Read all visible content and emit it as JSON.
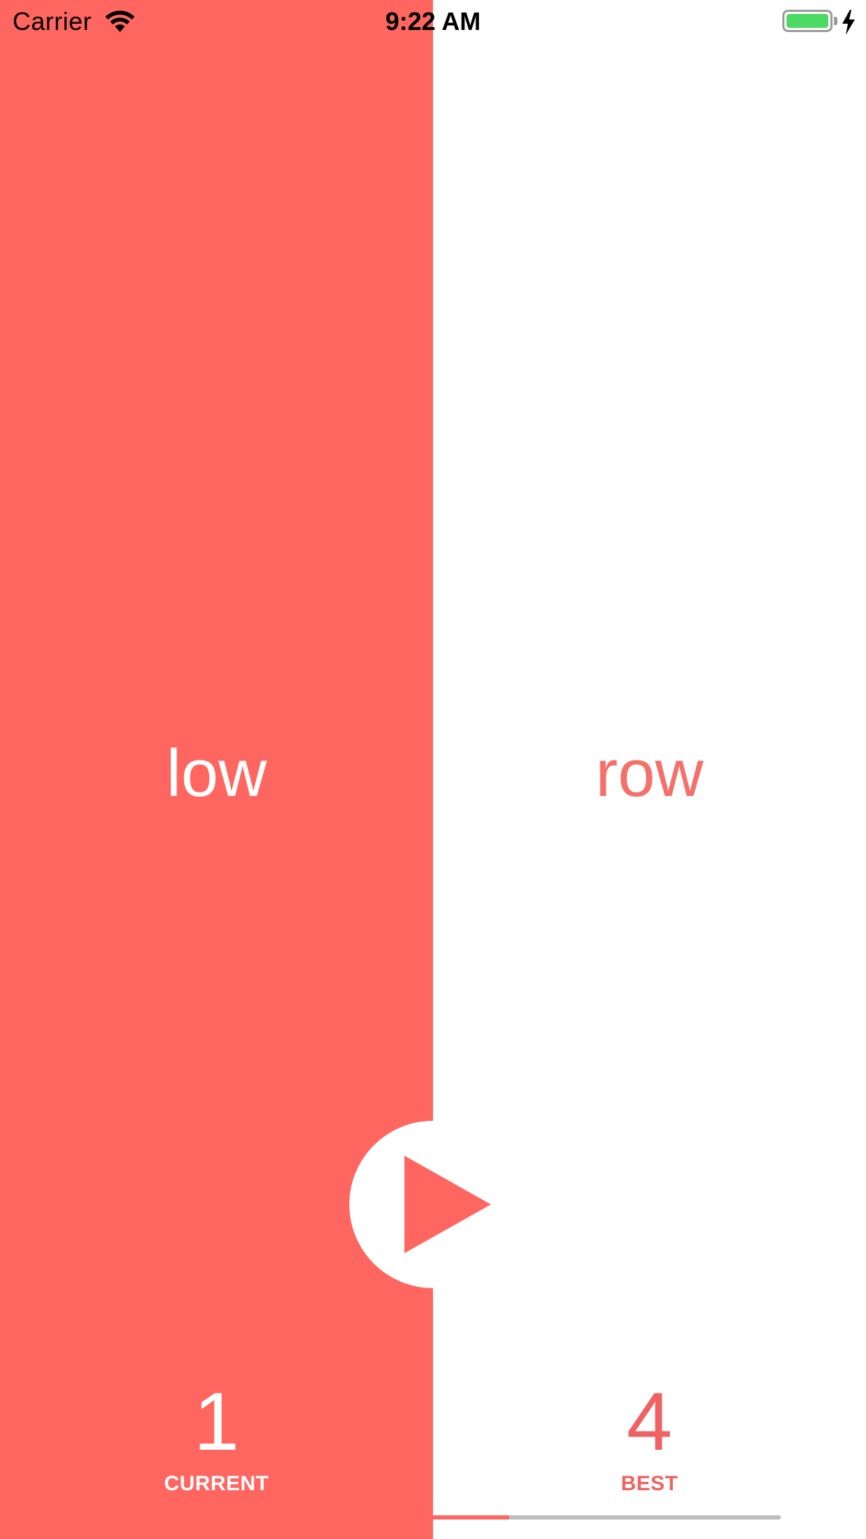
{
  "status_bar": {
    "carrier": "Carrier",
    "time": "9:22 AM",
    "wifi_icon": "wifi-icon",
    "battery_icon": "battery-icon",
    "charging_icon": "bolt-icon"
  },
  "options": {
    "left_word": "low",
    "right_word": "row"
  },
  "scores": {
    "current_value": "1",
    "current_label": "CURRENT",
    "best_value": "4",
    "best_label": "BEST"
  },
  "progress": {
    "fraction": 0.61
  },
  "colors": {
    "accent": "#FF6660",
    "accent_text": "#F47068",
    "battery": "#4CD964",
    "background": "#FFFFFF"
  },
  "play_button_icon": "play-icon"
}
